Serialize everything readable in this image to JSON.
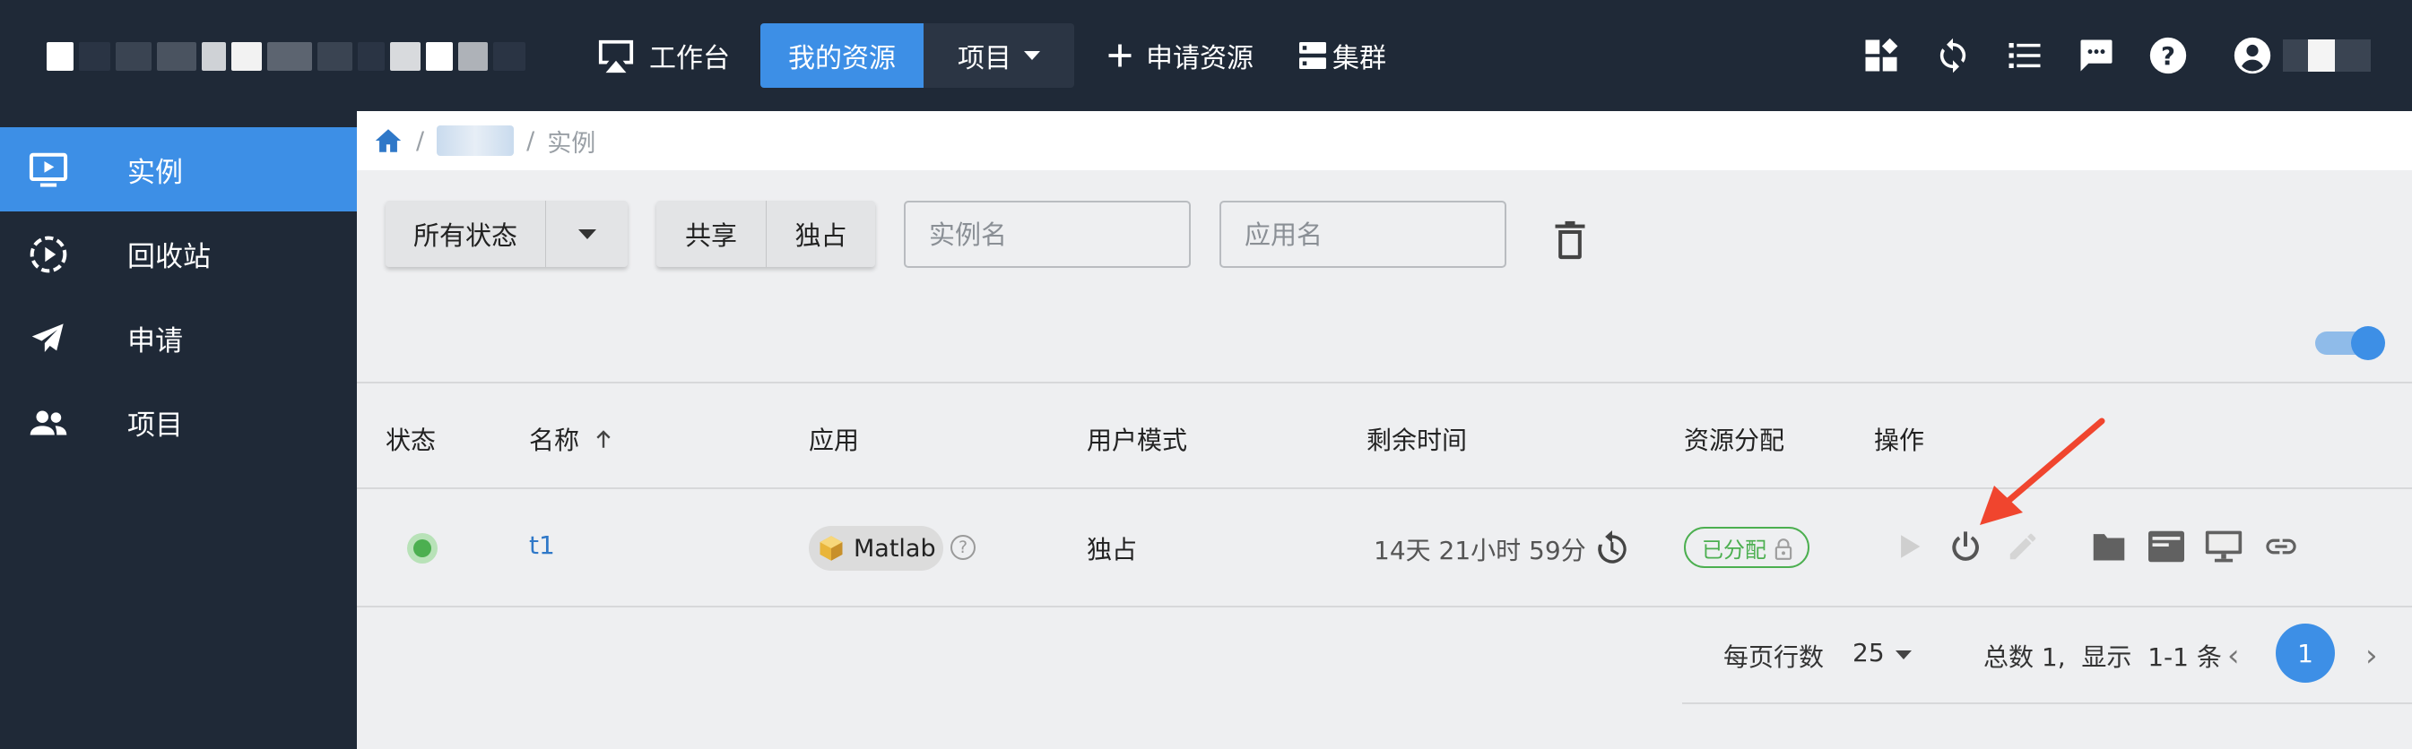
{
  "header": {
    "nav": {
      "workbench": "工作台",
      "my_resources": "我的资源",
      "project": "项目",
      "apply_resource": "申请资源",
      "cluster": "集群"
    },
    "icons": [
      "apps-add-icon",
      "sync-icon",
      "list-icon",
      "message-icon",
      "help-icon",
      "account-icon"
    ]
  },
  "sidebar": {
    "items": [
      {
        "label": "实例",
        "icon": "instance-icon",
        "active": true
      },
      {
        "label": "回收站",
        "icon": "recycle-icon",
        "active": false
      },
      {
        "label": "申请",
        "icon": "send-icon",
        "active": false
      },
      {
        "label": "项目",
        "icon": "group-icon",
        "active": false
      }
    ]
  },
  "breadcrumb": {
    "sep1": "/",
    "sep2": "/",
    "current": "实例"
  },
  "filters": {
    "status_label": "所有状态",
    "mode_shared": "共享",
    "mode_exclusive": "独占",
    "instance_placeholder": "实例名",
    "app_placeholder": "应用名"
  },
  "table": {
    "headers": {
      "status": "状态",
      "name": "名称",
      "app": "应用",
      "user_mode": "用户模式",
      "remaining": "剩余时间",
      "allocation": "资源分配",
      "actions": "操作"
    },
    "rows": [
      {
        "status": "running",
        "name": "t1",
        "app": "Matlab",
        "user_mode": "独占",
        "remaining": "14天 21小时 59分",
        "allocation": "已分配"
      }
    ]
  },
  "pagination": {
    "rows_per_page_label": "每页行数",
    "rows_per_page": "25",
    "summary": "总数 1,  显示  1-1 条",
    "current_page": "1"
  },
  "colors": {
    "nav_bg": "#1f2937",
    "accent": "#3d8fe6",
    "success": "#4caf50",
    "annotation": "#f0452e"
  }
}
